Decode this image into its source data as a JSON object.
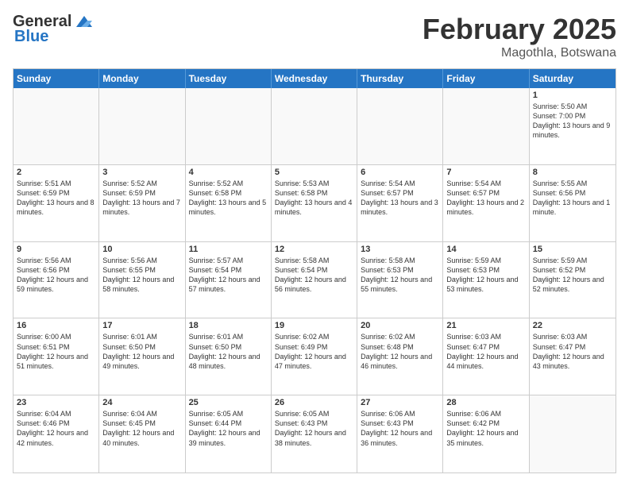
{
  "header": {
    "logo_general": "General",
    "logo_blue": "Blue",
    "month_title": "February 2025",
    "location": "Magothla, Botswana"
  },
  "days": [
    "Sunday",
    "Monday",
    "Tuesday",
    "Wednesday",
    "Thursday",
    "Friday",
    "Saturday"
  ],
  "weeks": [
    [
      {
        "date": "",
        "info": ""
      },
      {
        "date": "",
        "info": ""
      },
      {
        "date": "",
        "info": ""
      },
      {
        "date": "",
        "info": ""
      },
      {
        "date": "",
        "info": ""
      },
      {
        "date": "",
        "info": ""
      },
      {
        "date": "1",
        "info": "Sunrise: 5:50 AM\nSunset: 7:00 PM\nDaylight: 13 hours and 9 minutes."
      }
    ],
    [
      {
        "date": "2",
        "info": "Sunrise: 5:51 AM\nSunset: 6:59 PM\nDaylight: 13 hours and 8 minutes."
      },
      {
        "date": "3",
        "info": "Sunrise: 5:52 AM\nSunset: 6:59 PM\nDaylight: 13 hours and 7 minutes."
      },
      {
        "date": "4",
        "info": "Sunrise: 5:52 AM\nSunset: 6:58 PM\nDaylight: 13 hours and 5 minutes."
      },
      {
        "date": "5",
        "info": "Sunrise: 5:53 AM\nSunset: 6:58 PM\nDaylight: 13 hours and 4 minutes."
      },
      {
        "date": "6",
        "info": "Sunrise: 5:54 AM\nSunset: 6:57 PM\nDaylight: 13 hours and 3 minutes."
      },
      {
        "date": "7",
        "info": "Sunrise: 5:54 AM\nSunset: 6:57 PM\nDaylight: 13 hours and 2 minutes."
      },
      {
        "date": "8",
        "info": "Sunrise: 5:55 AM\nSunset: 6:56 PM\nDaylight: 13 hours and 1 minute."
      }
    ],
    [
      {
        "date": "9",
        "info": "Sunrise: 5:56 AM\nSunset: 6:56 PM\nDaylight: 12 hours and 59 minutes."
      },
      {
        "date": "10",
        "info": "Sunrise: 5:56 AM\nSunset: 6:55 PM\nDaylight: 12 hours and 58 minutes."
      },
      {
        "date": "11",
        "info": "Sunrise: 5:57 AM\nSunset: 6:54 PM\nDaylight: 12 hours and 57 minutes."
      },
      {
        "date": "12",
        "info": "Sunrise: 5:58 AM\nSunset: 6:54 PM\nDaylight: 12 hours and 56 minutes."
      },
      {
        "date": "13",
        "info": "Sunrise: 5:58 AM\nSunset: 6:53 PM\nDaylight: 12 hours and 55 minutes."
      },
      {
        "date": "14",
        "info": "Sunrise: 5:59 AM\nSunset: 6:53 PM\nDaylight: 12 hours and 53 minutes."
      },
      {
        "date": "15",
        "info": "Sunrise: 5:59 AM\nSunset: 6:52 PM\nDaylight: 12 hours and 52 minutes."
      }
    ],
    [
      {
        "date": "16",
        "info": "Sunrise: 6:00 AM\nSunset: 6:51 PM\nDaylight: 12 hours and 51 minutes."
      },
      {
        "date": "17",
        "info": "Sunrise: 6:01 AM\nSunset: 6:50 PM\nDaylight: 12 hours and 49 minutes."
      },
      {
        "date": "18",
        "info": "Sunrise: 6:01 AM\nSunset: 6:50 PM\nDaylight: 12 hours and 48 minutes."
      },
      {
        "date": "19",
        "info": "Sunrise: 6:02 AM\nSunset: 6:49 PM\nDaylight: 12 hours and 47 minutes."
      },
      {
        "date": "20",
        "info": "Sunrise: 6:02 AM\nSunset: 6:48 PM\nDaylight: 12 hours and 46 minutes."
      },
      {
        "date": "21",
        "info": "Sunrise: 6:03 AM\nSunset: 6:47 PM\nDaylight: 12 hours and 44 minutes."
      },
      {
        "date": "22",
        "info": "Sunrise: 6:03 AM\nSunset: 6:47 PM\nDaylight: 12 hours and 43 minutes."
      }
    ],
    [
      {
        "date": "23",
        "info": "Sunrise: 6:04 AM\nSunset: 6:46 PM\nDaylight: 12 hours and 42 minutes."
      },
      {
        "date": "24",
        "info": "Sunrise: 6:04 AM\nSunset: 6:45 PM\nDaylight: 12 hours and 40 minutes."
      },
      {
        "date": "25",
        "info": "Sunrise: 6:05 AM\nSunset: 6:44 PM\nDaylight: 12 hours and 39 minutes."
      },
      {
        "date": "26",
        "info": "Sunrise: 6:05 AM\nSunset: 6:43 PM\nDaylight: 12 hours and 38 minutes."
      },
      {
        "date": "27",
        "info": "Sunrise: 6:06 AM\nSunset: 6:43 PM\nDaylight: 12 hours and 36 minutes."
      },
      {
        "date": "28",
        "info": "Sunrise: 6:06 AM\nSunset: 6:42 PM\nDaylight: 12 hours and 35 minutes."
      },
      {
        "date": "",
        "info": ""
      }
    ]
  ]
}
